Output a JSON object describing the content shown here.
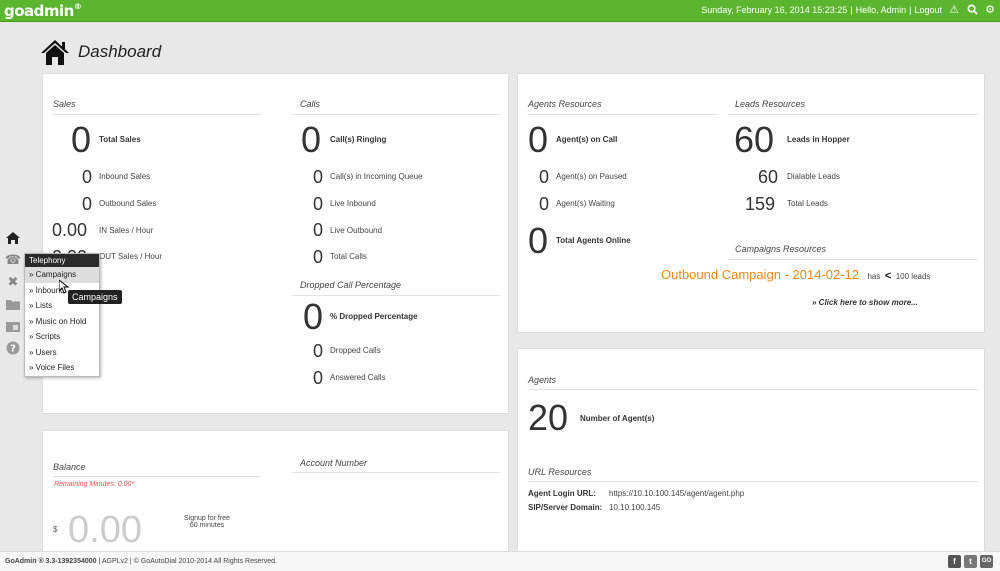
{
  "header": {
    "logo": "goadmin",
    "datetime": "Sunday, February 16, 2014 15:23:25",
    "greeting": "Hello, Admin",
    "logout": "Logout"
  },
  "page": {
    "title": "Dashboard"
  },
  "sales": {
    "title": "Sales",
    "total_value": "0",
    "total_label": "Total Sales",
    "inbound_value": "0",
    "inbound_label": "Inbound Sales",
    "outbound_value": "0",
    "outbound_label": "Outbound Sales",
    "in_hour_value": "0.00",
    "in_hour_label": "IN Sales / Hour",
    "out_hour_value": "0.00",
    "out_hour_label": "OUT Sales / Hour"
  },
  "calls": {
    "title": "Calls",
    "ringing_value": "0",
    "ringing_label": "Call(s) Ringing",
    "queue_value": "0",
    "queue_label": "Call(s) in Incoming Queue",
    "live_in_value": "0",
    "live_in_label": "Live Inbound",
    "live_out_value": "0",
    "live_out_label": "Live Outbound",
    "total_value": "0",
    "total_label": "Total Calls"
  },
  "dropped": {
    "title": "Dropped Call Percentage",
    "pct_value": "0",
    "pct_label": "% Dropped Percentage",
    "dropped_value": "0",
    "dropped_label": "Dropped Calls",
    "answered_value": "0",
    "answered_label": "Answered Calls"
  },
  "agents_res": {
    "title": "Agents Resources",
    "on_call_value": "0",
    "on_call_label": "Agent(s) on Call",
    "paused_value": "0",
    "paused_label": "Agent(s) on Paused",
    "waiting_value": "0",
    "waiting_label": "Agent(s) Waiting",
    "online_value": "0",
    "online_label": "Total Agents Online"
  },
  "leads_res": {
    "title": "Leads Resources",
    "hopper_value": "60",
    "hopper_label": "Leads in Hopper",
    "dialable_value": "60",
    "dialable_label": "Dialable Leads",
    "total_value": "159",
    "total_label": "Total Leads"
  },
  "campaigns_res": {
    "title": "Campaigns Resources",
    "campaign_name": "Outbound Campaign - 2014-02-12",
    "has": "has",
    "lt": "<",
    "leads": "100 leads",
    "show_more": "» Click here to show more..."
  },
  "agents": {
    "title": "Agents",
    "count_value": "20",
    "count_label": "Number of Agent(s)"
  },
  "url_res": {
    "title": "URL Resources",
    "login_label": "Agent Login URL:",
    "login_value": "https://10.10.100.145/agent/agent.php",
    "sip_label": "SIP/Server Domain:",
    "sip_value": "10.10.100.145"
  },
  "balance": {
    "title": "Balance",
    "remaining": "Remaining Minutes: 0.00*",
    "currency": "$",
    "amount": "0.00",
    "signup_line1": "Signup for free",
    "signup_line2": "60 minutes"
  },
  "account": {
    "title": "Account Number"
  },
  "menu": {
    "header": "Telephony",
    "items": [
      "» Campaigns",
      "» Inbound",
      "» Lists",
      "» Music on Hold",
      "» Scripts",
      "» Users",
      "» Voice Files"
    ],
    "tooltip": "Campaigns"
  },
  "footer": {
    "brand": "GoAdmin ® 3.3-1392354000",
    "license": " | AGPLv2 | © GoAutoDial 2010-2014 All Rights Reserved.",
    "social": [
      "f",
      "t",
      "GO"
    ]
  },
  "colors": {
    "green": "#5cb52e",
    "orange": "#e8891a",
    "red": "#d9534f"
  }
}
